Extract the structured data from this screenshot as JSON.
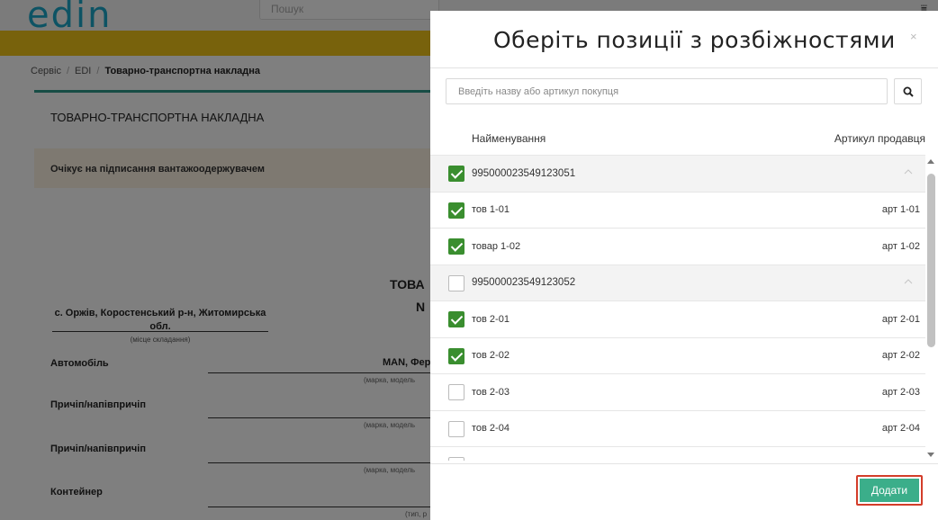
{
  "app": {
    "logo": "edin",
    "search_placeholder": "Пошук"
  },
  "breadcrumb": {
    "items": [
      "Сервіс",
      "EDI"
    ],
    "current": "Товарно-транспортна накладна"
  },
  "document": {
    "title": "ТОВАРНО-ТРАНСПОРТНА НАКЛАДНА",
    "status": "Очікує на підписання вантажоодержувачем",
    "big_title_partial": "ТОВА",
    "number_partial": "N",
    "place": "с. Оржів, Коростенський р-н, Житомирська обл.",
    "place_caption": "(місце складання)",
    "rows": [
      {
        "label": "Автомобіль",
        "caption": "(марка, модель",
        "value": "MAN, Фер"
      },
      {
        "label": "Причіп/напівпричіп",
        "caption": "(марка, модель",
        "value": ""
      },
      {
        "label": "Причіп/напівпричіп",
        "caption": "(марка, модель",
        "value": ""
      },
      {
        "label": "Контейнер",
        "caption": "(тип, р",
        "value": ""
      }
    ]
  },
  "modal": {
    "title": "Оберіть позиції з розбіжностями",
    "close": "×",
    "search_placeholder": "Введіть назву або артикул покупця",
    "columns": {
      "name": "Найменування",
      "article": "Артикул продавця"
    },
    "rows": [
      {
        "type": "group",
        "name": "995000023549123051",
        "article": "",
        "checked": true
      },
      {
        "type": "item",
        "name": "тов 1-01",
        "article": "арт 1-01",
        "checked": true
      },
      {
        "type": "item",
        "name": "товар 1-02",
        "article": "арт 1-02",
        "checked": true
      },
      {
        "type": "group",
        "name": "995000023549123052",
        "article": "",
        "checked": false
      },
      {
        "type": "item",
        "name": "тов 2-01",
        "article": "арт 2-01",
        "checked": true
      },
      {
        "type": "item",
        "name": "тов 2-02",
        "article": "арт 2-02",
        "checked": true
      },
      {
        "type": "item",
        "name": "тов 2-03",
        "article": "арт 2-03",
        "checked": false
      },
      {
        "type": "item",
        "name": "тов 2-04",
        "article": "арт 2-04",
        "checked": false
      },
      {
        "type": "item",
        "name": "",
        "article": "",
        "checked": false
      }
    ],
    "add_label": "Додати"
  },
  "colors": {
    "accent_green": "#3a8e2f",
    "button_green": "#3bae8a",
    "highlight_red": "#d33d2a",
    "banner_yellow": "#f0c419",
    "logo_blue": "#1aa6c8"
  },
  "icons": {
    "search": "search-icon",
    "filter": "filter-icon",
    "chevron_up": "chevron-up-icon"
  }
}
